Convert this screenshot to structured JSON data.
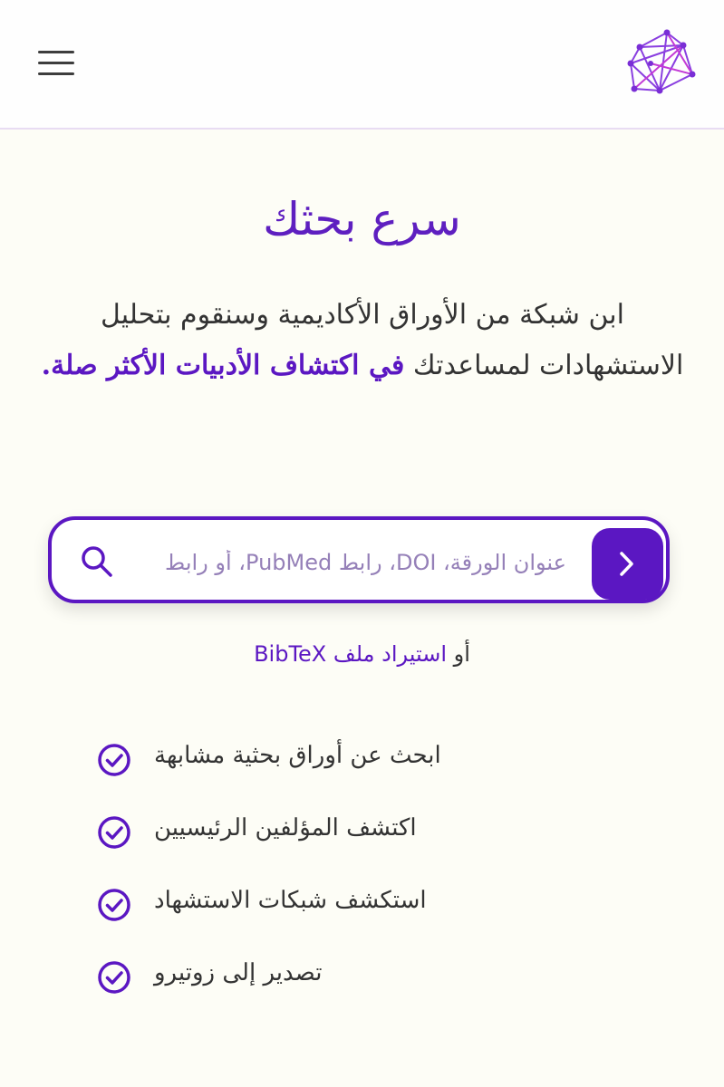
{
  "header": {
    "menu_icon": "hamburger-menu-icon",
    "logo_icon": "network-logo-icon"
  },
  "hero": {
    "title": "سرع بحثك",
    "description_part1": "ابن شبكة من الأوراق الأكاديمية وسنقوم بتحليل الاستشهادات لمساعدتك ",
    "description_highlight": "في اكتشاف الأدبيات الأكثر صلة",
    "description_end": "."
  },
  "search": {
    "placeholder": "عنوان الورقة، DOI، رابط PubMed، أو رابط",
    "icon": "search-icon",
    "button_icon": "chevron-right-icon"
  },
  "import": {
    "prefix": "أو ",
    "link_label": "استيراد ملف BibTeX"
  },
  "features": [
    {
      "label": "ابحث عن أوراق بحثية مشابهة",
      "icon": "check-circle-icon"
    },
    {
      "label": "اكتشف المؤلفين الرئيسيين",
      "icon": "check-circle-icon"
    },
    {
      "label": "استكشف شبكات الاستشهاد",
      "icon": "check-circle-icon"
    },
    {
      "label": "تصدير إلى زوتيرو",
      "icon": "check-circle-icon"
    }
  ],
  "colors": {
    "accent": "#5b17c2",
    "background": "#fdfdf6",
    "text": "#333333"
  }
}
